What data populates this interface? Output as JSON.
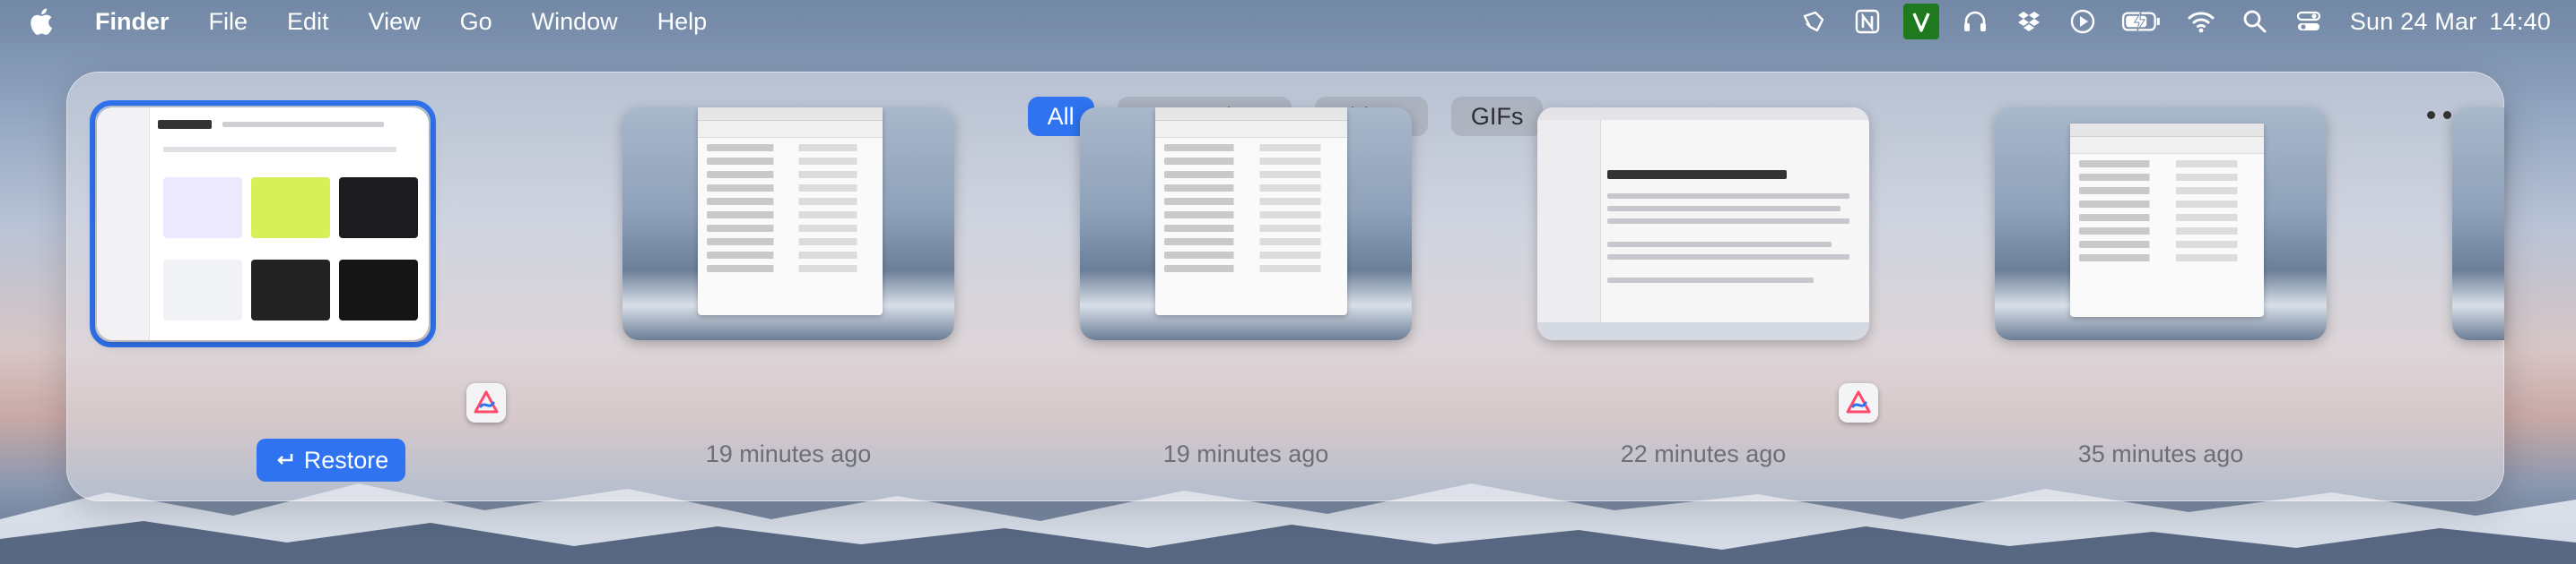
{
  "menubar": {
    "apple_icon": "apple-logo",
    "items": [
      "Finder",
      "File",
      "Edit",
      "View",
      "Go",
      "Window",
      "Help"
    ],
    "tray_icons": [
      "bookmark-icon",
      "notion-icon",
      "vim-icon",
      "headphones-icon",
      "dropbox-icon",
      "play-circle-icon",
      "battery-charging-icon",
      "wifi-icon",
      "search-icon",
      "control-center-icon"
    ],
    "date": "Sun 24 Mar",
    "time": "14:40"
  },
  "filters": {
    "items": [
      {
        "label": "All",
        "active": true
      },
      {
        "label": "Screenshots",
        "active": false
      },
      {
        "label": "Videos",
        "active": false
      },
      {
        "label": "GIFs",
        "active": false
      }
    ],
    "more_icon": "ellipsis-icon"
  },
  "thumbnails": [
    {
      "name": "thumbnail-1",
      "label": "Restore",
      "selected": true,
      "restore_icon": "return-arrow-icon",
      "badge_icon": "cleanshot-annotate-icon"
    },
    {
      "name": "thumbnail-2",
      "label": "19 minutes ago",
      "selected": false
    },
    {
      "name": "thumbnail-3",
      "label": "19 minutes ago",
      "selected": false
    },
    {
      "name": "thumbnail-4",
      "label": "22 minutes ago",
      "selected": false,
      "badge_icon": "cleanshot-annotate-icon"
    },
    {
      "name": "thumbnail-5",
      "label": "35 minutes ago",
      "selected": false
    }
  ],
  "colors": {
    "accent": "#2f73f0",
    "label_gray": "#6c6e78"
  }
}
